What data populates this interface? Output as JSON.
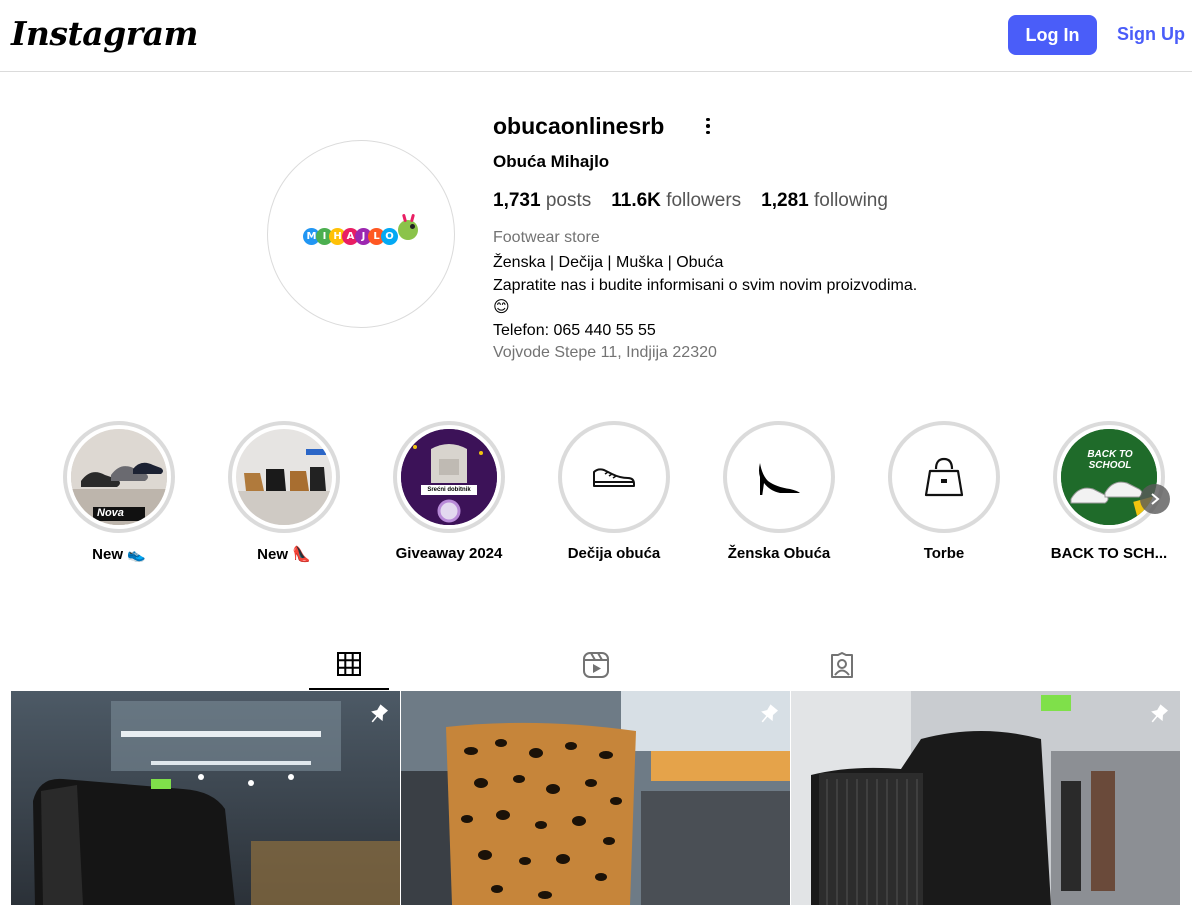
{
  "header": {
    "logo_text": "Instagram",
    "login_label": "Log In",
    "signup_label": "Sign Up",
    "accent_color": "#4a5df9"
  },
  "profile": {
    "username": "obucaonlinesrb",
    "full_name": "Obuća Mihajlo",
    "avatar_text": "MIHAJLO",
    "stats": {
      "posts_count": "1,731",
      "posts_label": "posts",
      "followers_count": "11.6K",
      "followers_label": "followers",
      "following_count": "1,281",
      "following_label": "following"
    },
    "category": "Footwear store",
    "bio_line1": "Ženska | Dečija | Muška | Obuća",
    "bio_line2": "Zapratite nas i budite informisani o svim novim proizvodima.",
    "bio_emoji": "😊",
    "bio_phone": "Telefon: 065 440 55 55",
    "bio_address": "Vojvode Stepe 11, Indjija 22320"
  },
  "highlights": [
    {
      "label": "New 👟",
      "overlay_text": "Nova",
      "icon": "sneakers-photo"
    },
    {
      "label": "New 👠",
      "overlay_text": "",
      "icon": "heels-photo"
    },
    {
      "label": "Giveaway 2024",
      "overlay_text": "Srećni dobitnik",
      "icon": "bag-giveaway-photo"
    },
    {
      "label": "Dečija obuća",
      "overlay_text": "",
      "icon": "sneaker-icon"
    },
    {
      "label": "Ženska Obuća",
      "overlay_text": "",
      "icon": "high-heel-icon"
    },
    {
      "label": "Torbe",
      "overlay_text": "",
      "icon": "handbag-icon"
    },
    {
      "label": "BACK TO SCH...",
      "overlay_text": "BACK TO SCHOOL",
      "icon": "back-to-school-photo"
    }
  ],
  "tabs": [
    {
      "name": "posts",
      "icon": "grid-icon",
      "active": true
    },
    {
      "name": "reels",
      "icon": "reels-icon",
      "active": false
    },
    {
      "name": "tagged",
      "icon": "tagged-icon",
      "active": false
    }
  ],
  "posts": [
    {
      "subject": "black leather boot",
      "pinned": true
    },
    {
      "subject": "leopard print boot",
      "pinned": true
    },
    {
      "subject": "black suede chelsea boot",
      "pinned": true
    }
  ]
}
